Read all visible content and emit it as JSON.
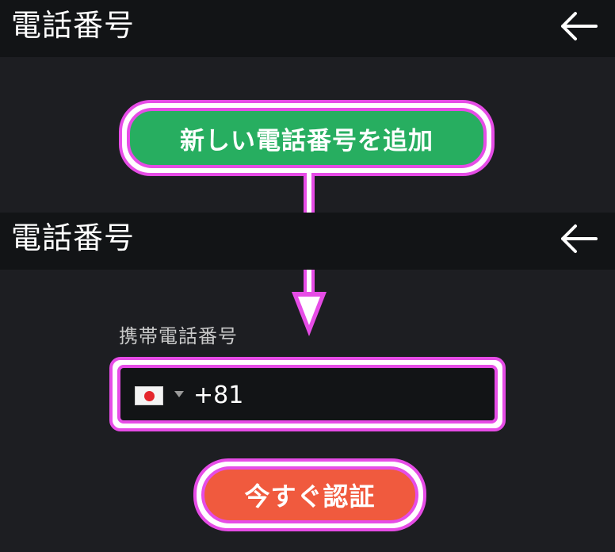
{
  "header_top": {
    "title": "電話番号",
    "back_icon": "arrow-left-icon"
  },
  "callout": {
    "label": "新しい電話番号を追加",
    "color": "#27ae60",
    "outline": "#e64ce6"
  },
  "header_second": {
    "title": "電話番号",
    "back_icon": "arrow-left-icon"
  },
  "phone_field": {
    "label": "携帯電話番号",
    "country_flag": "japan-flag-icon",
    "dial_code": "+81"
  },
  "verify_button": {
    "label": "今すぐ認証",
    "color": "#f05a3e"
  }
}
